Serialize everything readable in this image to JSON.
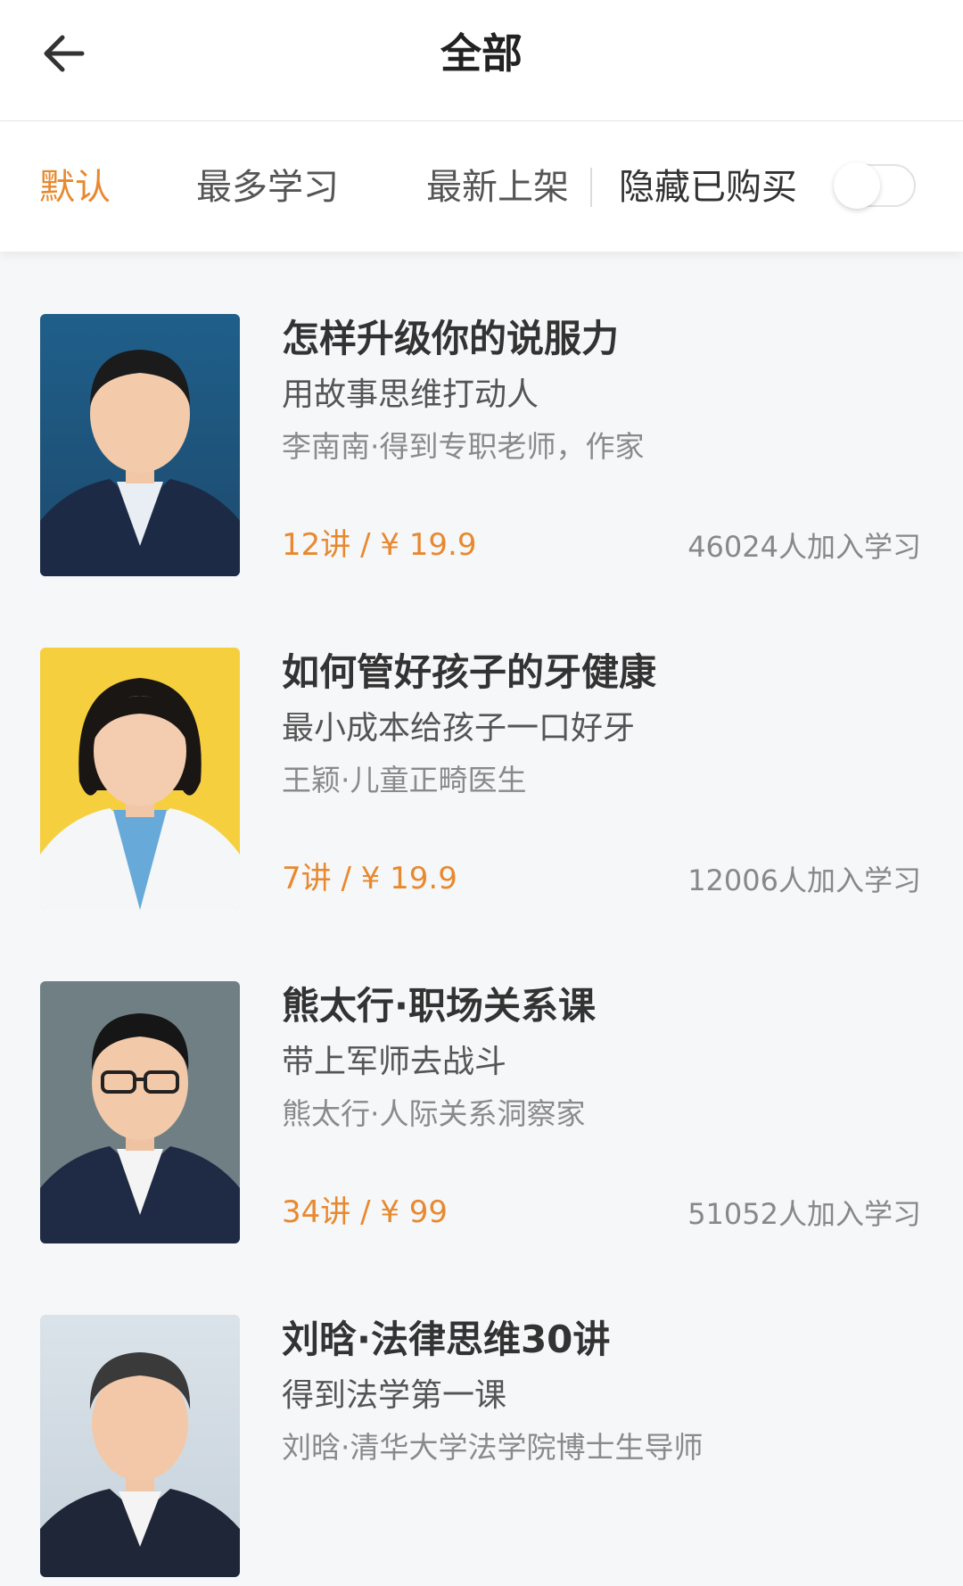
{
  "header": {
    "title": "全部",
    "back_icon": "arrow-left-icon"
  },
  "filters": {
    "tabs": [
      {
        "label": "默认",
        "active": true
      },
      {
        "label": "最多学习",
        "active": false
      },
      {
        "label": "最新上架",
        "active": false
      }
    ],
    "hide_purchased_label": "隐藏已购买",
    "hide_purchased_on": false
  },
  "colors": {
    "accent": "#e8892f",
    "background": "#f6f7f9"
  },
  "courses": [
    {
      "title": "怎样升级你的说服力",
      "subtitle": "用故事思维打动人",
      "author": "李南南·得到专职老师，作家",
      "price": "12讲 / ¥ 19.9",
      "learners": "46024人加入学习",
      "cover_bg": "#1f5f8a"
    },
    {
      "title": "如何管好孩子的牙健康",
      "subtitle": "最小成本给孩子一口好牙",
      "author": "王颖·儿童正畸医生",
      "price": "7讲 / ¥ 19.9",
      "learners": "12006人加入学习",
      "cover_bg": "#f6cf3f"
    },
    {
      "title": "熊太行·职场关系课",
      "subtitle": "带上军师去战斗",
      "author": "熊太行·人际关系洞察家",
      "price": "34讲 / ¥ 99",
      "learners": "51052人加入学习",
      "cover_bg": "#6f7f84"
    },
    {
      "title": "刘晗·法律思维30讲",
      "subtitle": "得到法学第一课",
      "author": "刘晗·清华大学法学院博士生导师",
      "price": "",
      "learners": "",
      "cover_bg": "#cfd8df"
    }
  ]
}
